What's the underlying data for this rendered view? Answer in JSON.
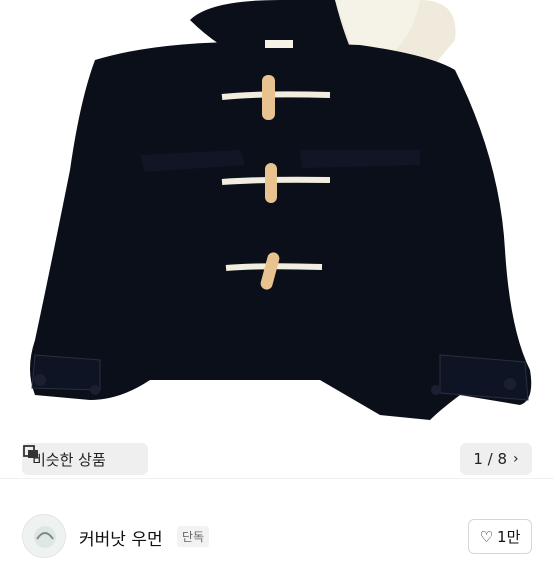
{
  "product": {
    "image_alt": "",
    "similar_label": "비슷한 상품",
    "pager": {
      "current": 1,
      "total": 8,
      "text": "1 / 8"
    }
  },
  "shop": {
    "name": "커버낫 우먼",
    "badge": "단독",
    "likes": "1만"
  },
  "icons": {
    "similar": "similar-products-icon",
    "next": "chevron-right-icon",
    "heart": "heart-icon",
    "avatar": "shop-avatar"
  },
  "colors": {
    "coat": "#0b0f1a",
    "toggle": "#e8c28f",
    "rope": "#f1eddf"
  }
}
